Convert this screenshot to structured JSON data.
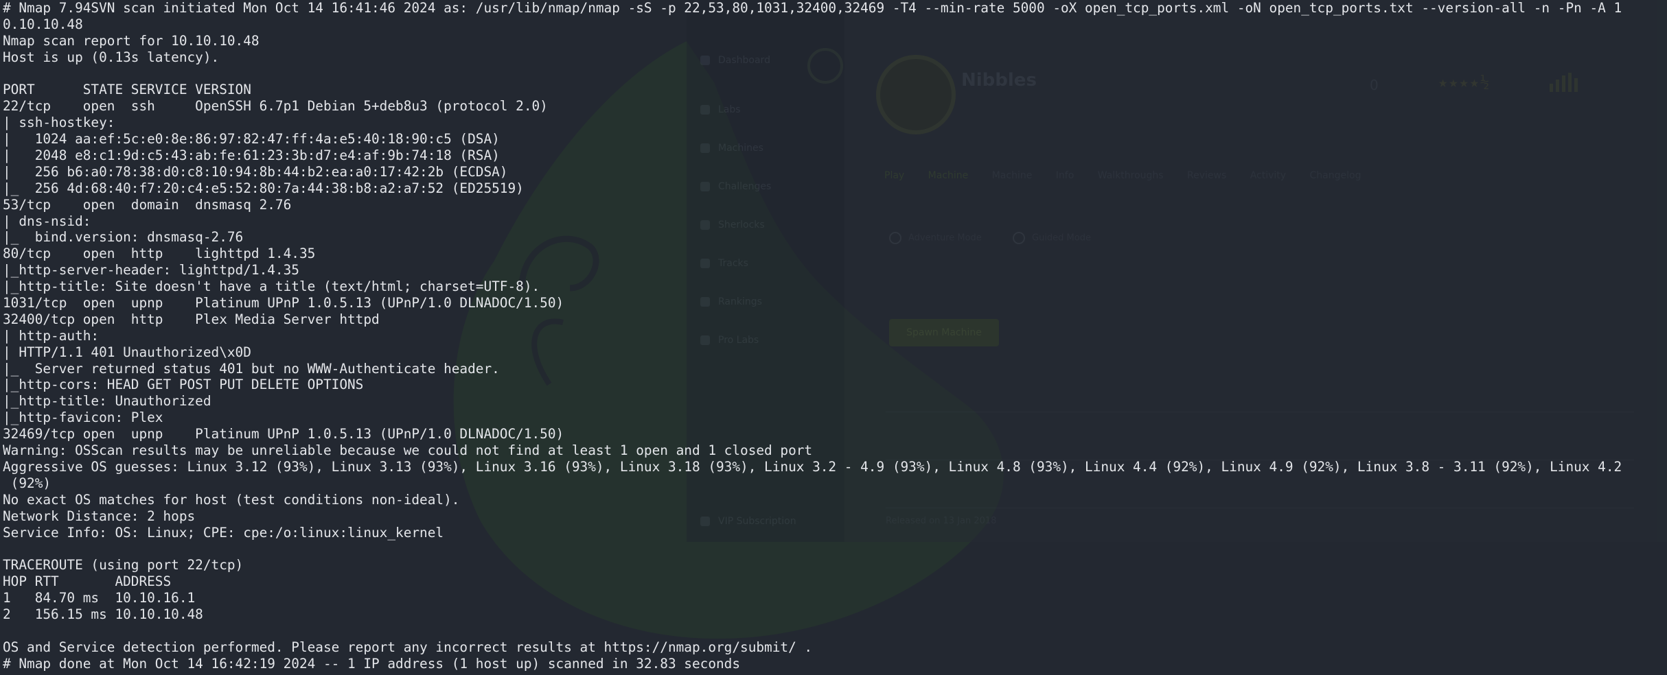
{
  "terminal": {
    "lines": [
      "# Nmap 7.94SVN scan initiated Mon Oct 14 16:41:46 2024 as: /usr/lib/nmap/nmap -sS -p 22,53,80,1031,32400,32469 -T4 --min-rate 5000 -oX open_tcp_ports.xml -oN open_tcp_ports.txt --version-all -n -Pn -A 1",
      "0.10.10.48",
      "Nmap scan report for 10.10.10.48",
      "Host is up (0.13s latency).",
      "",
      "PORT      STATE SERVICE VERSION",
      "22/tcp    open  ssh     OpenSSH 6.7p1 Debian 5+deb8u3 (protocol 2.0)",
      "| ssh-hostkey: ",
      "|   1024 aa:ef:5c:e0:8e:86:97:82:47:ff:4a:e5:40:18:90:c5 (DSA)",
      "|   2048 e8:c1:9d:c5:43:ab:fe:61:23:3b:d7:e4:af:9b:74:18 (RSA)",
      "|   256 b6:a0:78:38:d0:c8:10:94:8b:44:b2:ea:a0:17:42:2b (ECDSA)",
      "|_  256 4d:68:40:f7:20:c4:e5:52:80:7a:44:38:b8:a2:a7:52 (ED25519)",
      "53/tcp    open  domain  dnsmasq 2.76",
      "| dns-nsid: ",
      "|_  bind.version: dnsmasq-2.76",
      "80/tcp    open  http    lighttpd 1.4.35",
      "|_http-server-header: lighttpd/1.4.35",
      "|_http-title: Site doesn't have a title (text/html; charset=UTF-8).",
      "1031/tcp  open  upnp    Platinum UPnP 1.0.5.13 (UPnP/1.0 DLNADOC/1.50)",
      "32400/tcp open  http    Plex Media Server httpd",
      "| http-auth: ",
      "| HTTP/1.1 401 Unauthorized\\x0D",
      "|_  Server returned status 401 but no WWW-Authenticate header.",
      "|_http-cors: HEAD GET POST PUT DELETE OPTIONS",
      "|_http-title: Unauthorized",
      "|_http-favicon: Plex",
      "32469/tcp open  upnp    Platinum UPnP 1.0.5.13 (UPnP/1.0 DLNADOC/1.50)",
      "Warning: OSScan results may be unreliable because we could not find at least 1 open and 1 closed port",
      "Aggressive OS guesses: Linux 3.12 (93%), Linux 3.13 (93%), Linux 3.16 (93%), Linux 3.18 (93%), Linux 3.2 - 4.9 (93%), Linux 4.8 (93%), Linux 4.4 (92%), Linux 4.9 (92%), Linux 3.8 - 3.11 (92%), Linux 4.2",
      " (92%)",
      "No exact OS matches for host (test conditions non-ideal).",
      "Network Distance: 2 hops",
      "Service Info: OS: Linux; CPE: cpe:/o:linux:linux_kernel",
      "",
      "TRACEROUTE (using port 22/tcp)",
      "HOP RTT       ADDRESS",
      "1   84.70 ms  10.10.16.1",
      "2   156.15 ms 10.10.10.48",
      "",
      "OS and Service detection performed. Please report any incorrect results at https://nmap.org/submit/ .",
      "# Nmap done at Mon Oct 14 16:42:19 2024 -- 1 IP address (1 host up) scanned in 32.83 seconds"
    ]
  },
  "ghost_window": {
    "machine_name": "Nibbles",
    "stat_value": "0",
    "stars": "★★★★½",
    "tabs": [
      "Play Machine",
      "Machine Info",
      "Walkthroughs",
      "Reviews",
      "Activity",
      "Changelog"
    ],
    "radio_options": [
      "Adventure Mode",
      "Guided Mode"
    ],
    "button_label": "Spawn Machine",
    "footer_text": "Released on 13 Jan 2018",
    "sidebar_items": [
      "Dashboard",
      "Labs",
      "Machines",
      "Challenges",
      "Sherlocks",
      "Tracks",
      "Rankings",
      "Pro Labs",
      "",
      "",
      "VIP Subscription"
    ],
    "colors": {
      "background": "#232831",
      "text": "#e4e6ea",
      "wallpaper_green": "#2a3b34"
    }
  }
}
